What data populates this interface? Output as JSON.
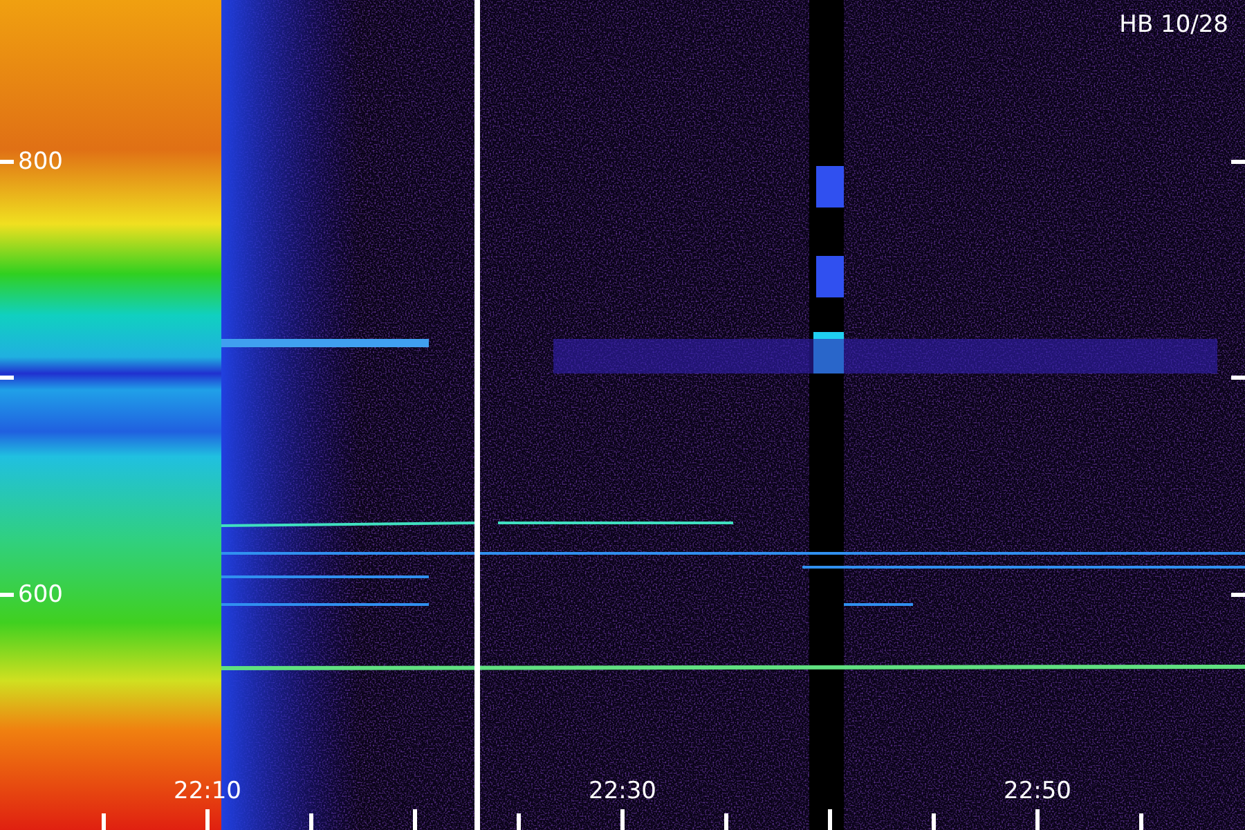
{
  "plot": {
    "title": "HB 10/28",
    "y_labels": [
      "800",
      "600"
    ],
    "x_labels": [
      "22:10",
      "22:30",
      "22:50"
    ]
  }
}
